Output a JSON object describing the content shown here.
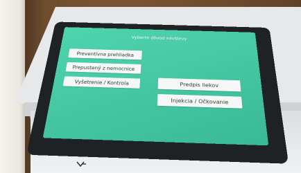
{
  "screen": {
    "title": "Vyberte dôvod návštevy",
    "buttons": [
      {
        "label": "Preventívna prehliadka"
      },
      {
        "label": "Prepustený z nemocnice"
      },
      {
        "label": "Vyšetrenie / Kontrola"
      },
      {
        "label": "Predpis liekov"
      },
      {
        "label": "Injekcia / Očkovanie"
      }
    ]
  },
  "colors": {
    "screen_bg": "#47c9a4",
    "button_bg": "#f6f8f7",
    "button_text": "#2d3a36",
    "bezel": "#1f2224",
    "kiosk_body": "#e7e8e9"
  }
}
